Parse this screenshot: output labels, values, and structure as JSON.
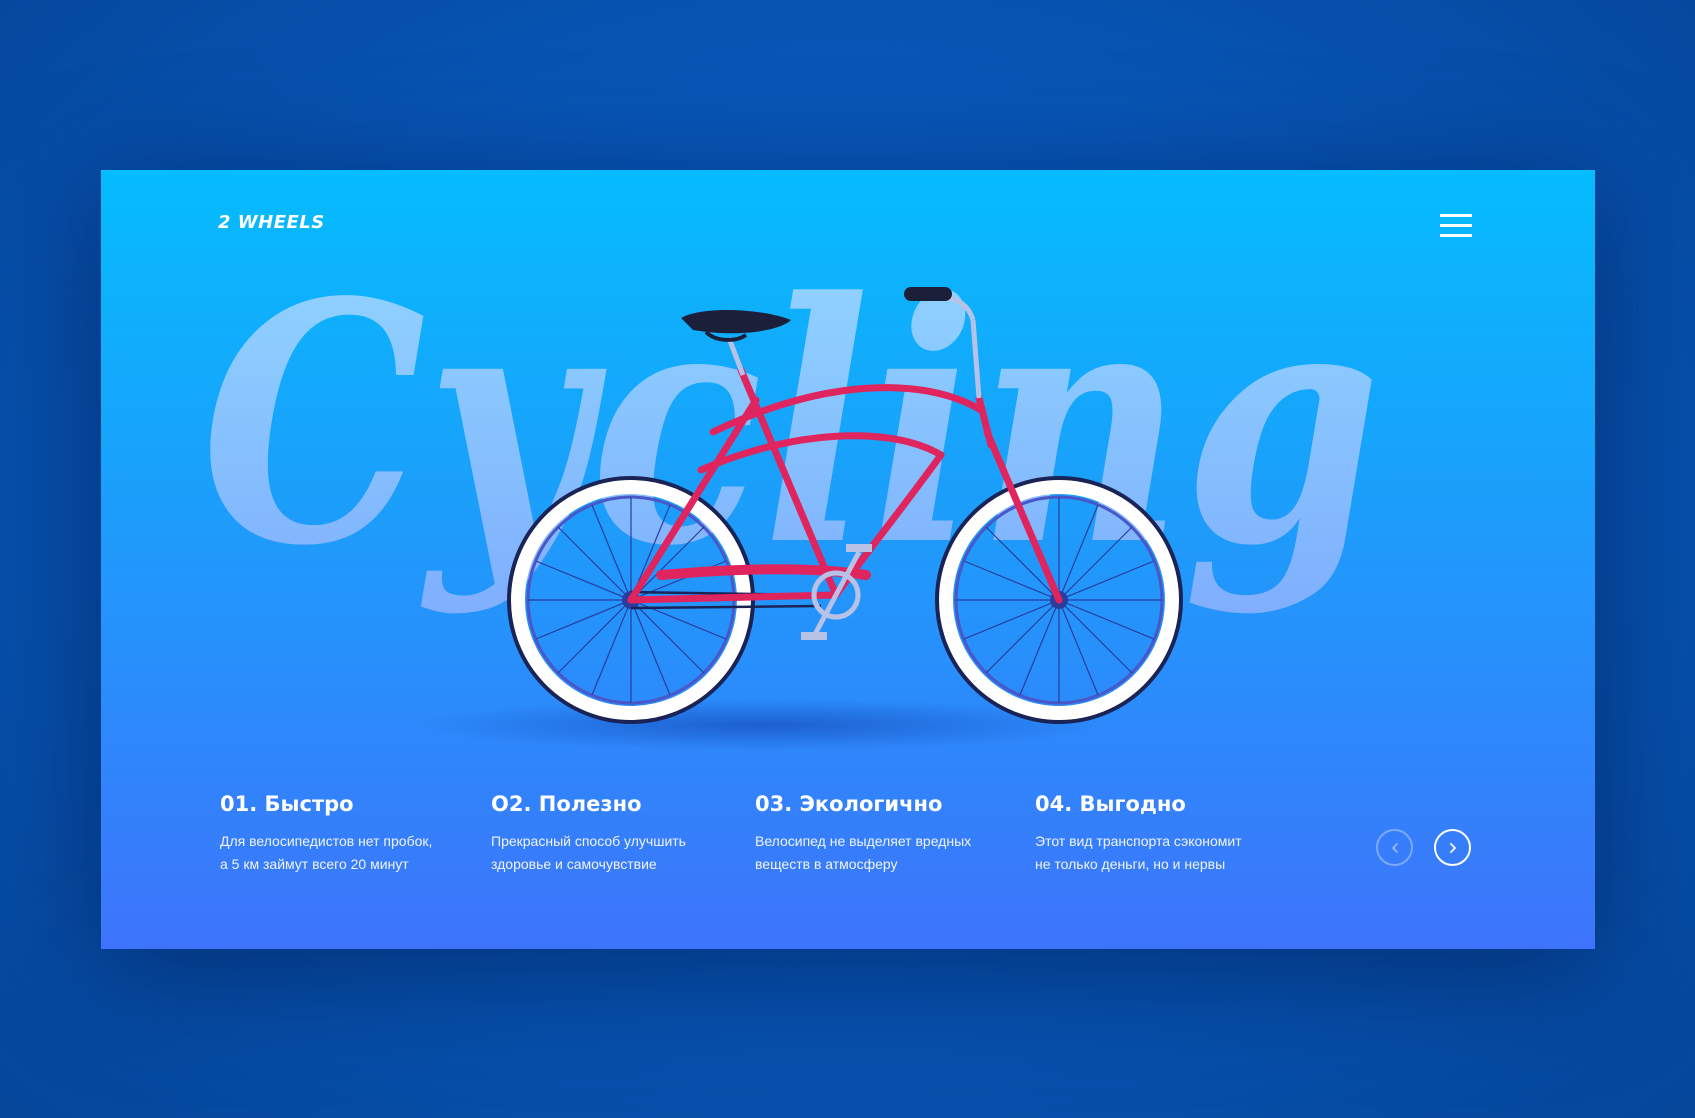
{
  "brand": {
    "logo_text": "2 WHEELS"
  },
  "hero": {
    "word": "Cycling"
  },
  "features": [
    {
      "title": "01. Быстро",
      "description_lines": [
        "Для велосипедистов нет пробок,",
        "а 5 км займут всего 20 минут"
      ]
    },
    {
      "title": "O2. Полезно",
      "description_lines": [
        "Прекрасный способ улучшить",
        "здоровье  и самочувствие"
      ]
    },
    {
      "title": "03. Экологично",
      "description_lines": [
        "Велосипед не выделяет вредных",
        "веществ в атмосферу"
      ]
    },
    {
      "title": "04. Выгодно",
      "description_lines": [
        "Этот вид транспорта сэкономит",
        "не только деньги, но и нервы"
      ]
    }
  ],
  "icons": {
    "menu": "hamburger-menu-icon",
    "prev": "chevron-left-icon",
    "next": "chevron-right-icon"
  },
  "colors": {
    "card_top": "#05bcfd",
    "card_bottom": "#3e74fb",
    "page_background": "#0757b8",
    "bike_frame": "#e0245e",
    "tire_wall": "#ffffff",
    "text": "#ffffff"
  }
}
